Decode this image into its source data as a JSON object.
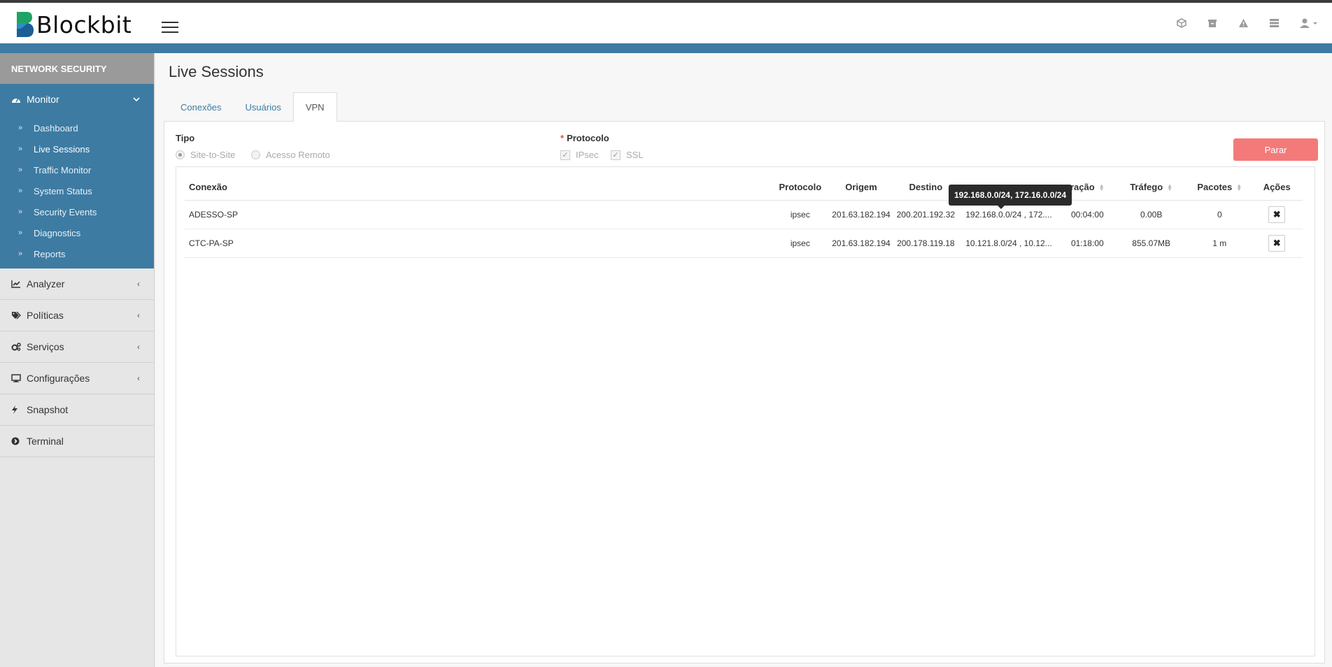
{
  "brand": {
    "name": "Blockbit"
  },
  "sidebar": {
    "section_title": "NETWORK SECURITY",
    "monitor": {
      "label": "Monitor",
      "items": [
        {
          "label": "Dashboard"
        },
        {
          "label": "Live Sessions"
        },
        {
          "label": "Traffic Monitor"
        },
        {
          "label": "System Status"
        },
        {
          "label": "Security Events"
        },
        {
          "label": "Diagnostics"
        },
        {
          "label": "Reports"
        }
      ]
    },
    "menus": [
      {
        "label": "Analyzer"
      },
      {
        "label": "Políticas"
      },
      {
        "label": "Serviços"
      },
      {
        "label": "Configurações"
      },
      {
        "label": "Snapshot"
      },
      {
        "label": "Terminal"
      }
    ]
  },
  "page": {
    "title": "Live Sessions",
    "tabs": [
      {
        "label": "Conexões"
      },
      {
        "label": "Usuários"
      },
      {
        "label": "VPN"
      }
    ]
  },
  "filters": {
    "type_label": "Tipo",
    "type_options": [
      {
        "label": "Site-to-Site"
      },
      {
        "label": "Acesso Remoto"
      }
    ],
    "protocol_required": "*",
    "protocol_label": "Protocolo",
    "protocol_options": [
      {
        "label": "IPsec"
      },
      {
        "label": "SSL"
      }
    ],
    "stop_label": "Parar"
  },
  "table": {
    "headers": {
      "connection": "Conexão",
      "protocol": "Protocolo",
      "origin": "Origem",
      "destination": "Destino",
      "duration": "ração",
      "traffic": "Tráfego",
      "packets": "Pacotes",
      "actions": "Ações"
    },
    "rows": [
      {
        "connection": "ADESSO-SP",
        "protocol": "ipsec",
        "origin": "201.63.182.194",
        "destination": "200.201.192.32",
        "networks": "192.168.0.0/24 , 172....",
        "duration": "00:04:00",
        "traffic": "0.00B",
        "packets": "0"
      },
      {
        "connection": "CTC-PA-SP",
        "protocol": "ipsec",
        "origin": "201.63.182.194",
        "destination": "200.178.119.18",
        "networks": "10.121.8.0/24 , 10.12...",
        "duration": "01:18:00",
        "traffic": "855.07MB",
        "packets": "1 m"
      }
    ],
    "remove_glyph": "✖"
  },
  "tooltip": {
    "text": "192.168.0.0/24, 172.16.0.0/24"
  },
  "colors": {
    "accent": "#3d7ba3",
    "stop": "#f47a7a",
    "section": "#9a9a9a"
  }
}
